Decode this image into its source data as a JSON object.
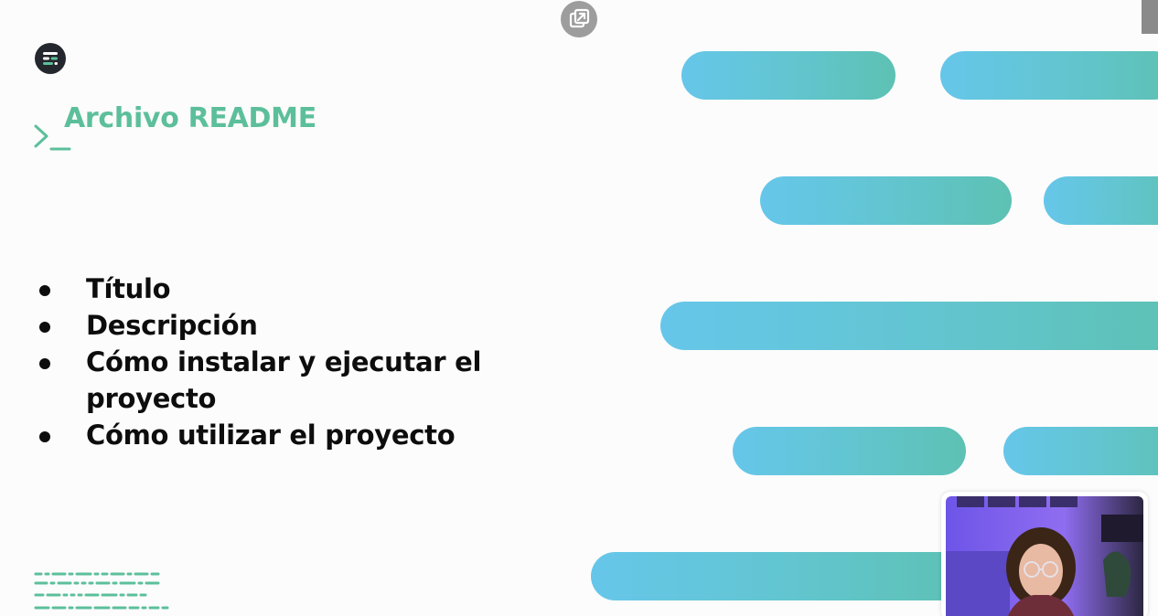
{
  "slide": {
    "title": "Archivo README",
    "bullets": [
      "Título",
      "Descripción",
      "Cómo instalar y ejecutar el proyecto",
      "Cómo utilizar el proyecto"
    ]
  },
  "icons": {
    "logo": "logo-icon",
    "popout": "popout-icon",
    "prompt": "terminal-prompt-icon"
  },
  "colors": {
    "title": "#5cbf9b",
    "bar_start": "#66c6ea",
    "bar_end": "#5dc1b3",
    "bullet_text": "#0d0d0d"
  }
}
